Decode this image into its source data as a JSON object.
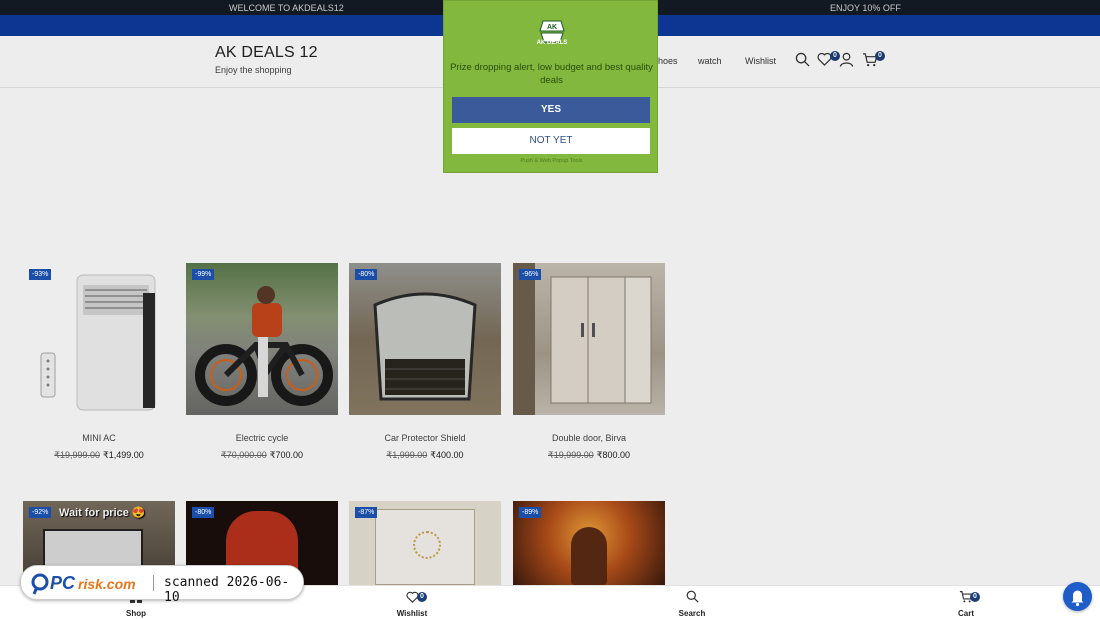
{
  "topbar": {
    "welcome": "WELCOME TO AKDEALS12",
    "offer": "ENJOY 10% OFF"
  },
  "header": {
    "brand_title": "AK DEALS 12",
    "brand_tagline": "Enjoy the shopping",
    "nav": [
      "hoes",
      "watch",
      "Wishlist"
    ],
    "wishlist_count": "0",
    "cart_count": "0",
    "icons": [
      "search-icon",
      "heart-icon",
      "user-icon",
      "cart-icon"
    ]
  },
  "popup": {
    "logo_text": "AK DEALS",
    "message": "Prize dropping alert, low budget and best quality deals",
    "yes_label": "YES",
    "no_label": "NOT YET",
    "powered": "Push & Web Popup Tools"
  },
  "products": [
    {
      "name": "MINI AC",
      "old_price": "₹19,999.00",
      "price": "₹1,499.00",
      "discount": "-93%"
    },
    {
      "name": "Electric cycle",
      "old_price": "₹70,000.00",
      "price": "₹700.00",
      "discount": "-99%"
    },
    {
      "name": "Car Protector Shield",
      "old_price": "₹1,999.00",
      "price": "₹400.00",
      "discount": "-80%"
    },
    {
      "name": "Double door, Birva",
      "old_price": "₹19,999.00",
      "price": "₹800.00",
      "discount": "-96%"
    }
  ],
  "products_row2": [
    {
      "discount": "-92%",
      "caption": "Wait for price 😍"
    },
    {
      "discount": "-80%"
    },
    {
      "discount": "-87%"
    },
    {
      "discount": "-89%"
    }
  ],
  "bottom_nav": [
    {
      "label": "Shop",
      "icon": "grid-icon"
    },
    {
      "label": "Wishlist",
      "icon": "heart-icon",
      "badge": "0"
    },
    {
      "label": "Search",
      "icon": "search-icon"
    },
    {
      "label": "Cart",
      "icon": "cart-icon",
      "badge": "0"
    }
  ],
  "watermark": {
    "brand": "PCrisk.com",
    "text": "scanned 2026-06-10"
  },
  "colors": {
    "accent_blue": "#0d3b9c",
    "popup_green": "#83b83f",
    "badge": "#1d3f7a"
  }
}
